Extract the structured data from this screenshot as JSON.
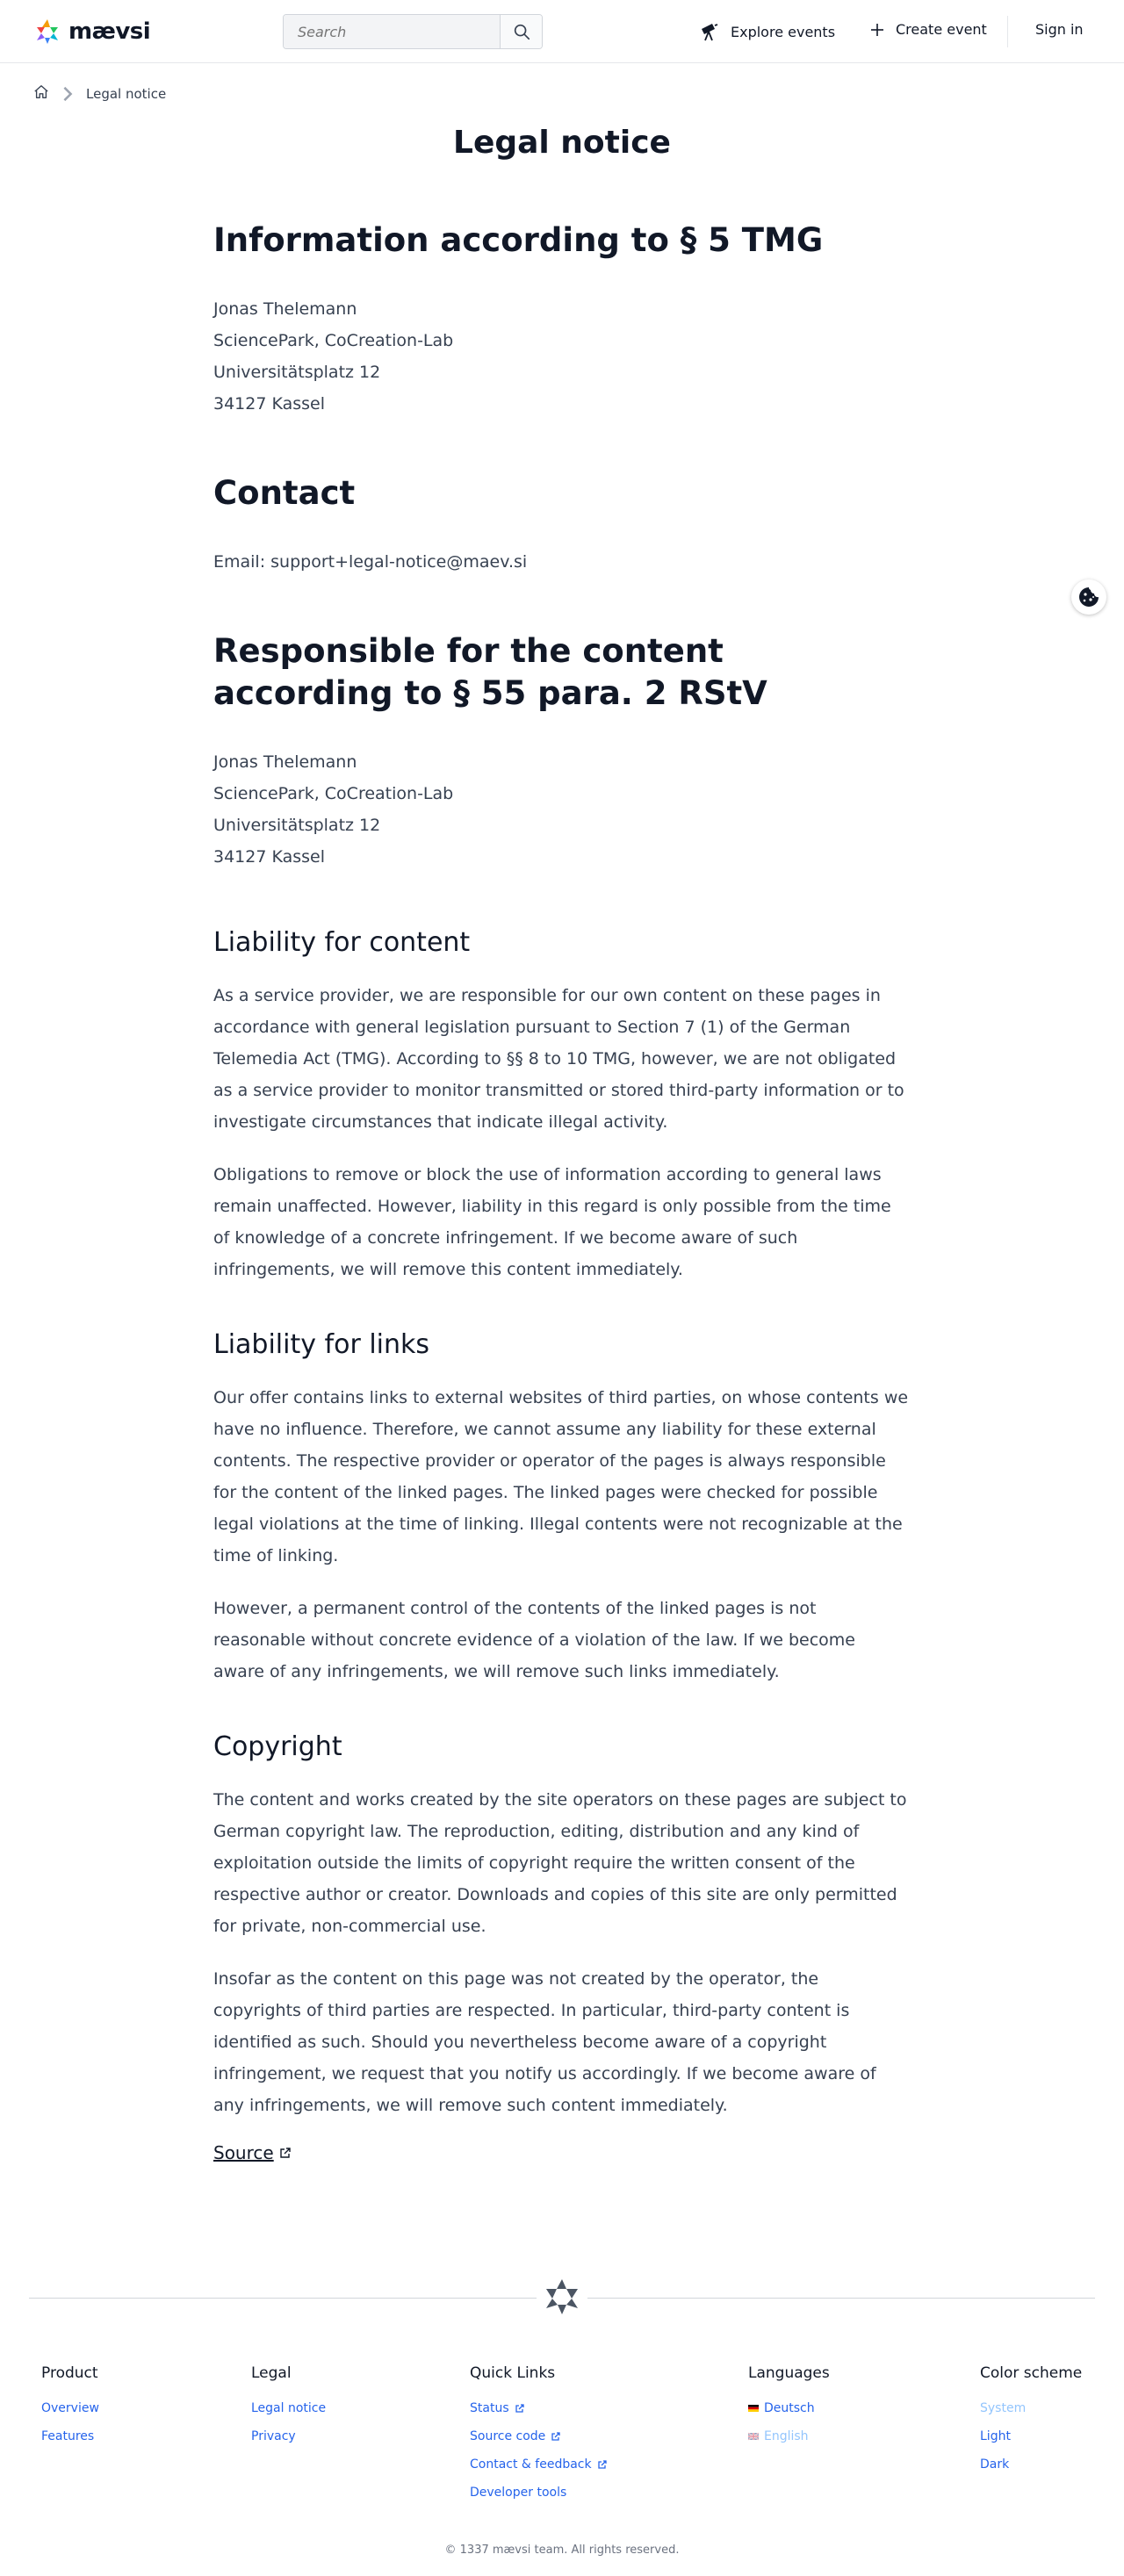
{
  "header": {
    "logo_text": "mævsi",
    "search_placeholder": "Search",
    "explore_label": "Explore events",
    "create_label": "Create event",
    "signin_label": "Sign in"
  },
  "breadcrumb": {
    "current": "Legal notice"
  },
  "page_title": "Legal notice",
  "sections": {
    "info": {
      "heading": "Information according to § 5 TMG",
      "lines": [
        "Jonas Thelemann",
        "SciencePark, CoCreation-Lab",
        "Universitätsplatz 12",
        "34127 Kassel"
      ]
    },
    "contact": {
      "heading": "Contact",
      "email": "Email: support+legal-notice@maev.si"
    },
    "responsible": {
      "heading": "Responsible for the content according to § 55 para. 2 RStV",
      "lines": [
        "Jonas Thelemann",
        "SciencePark, CoCreation-Lab",
        "Universitätsplatz 12",
        "34127 Kassel"
      ]
    },
    "liability_content": {
      "heading": "Liability for content",
      "paragraphs": [
        "As a service provider, we are responsible for our own content on these pages in accordance with general legislation pursuant to Section 7 (1) of the German Telemedia Act (TMG). According to §§ 8 to 10 TMG, however, we are not obligated as a service provider to monitor transmitted or stored third-party information or to investigate circumstances that indicate illegal activity.",
        "Obligations to remove or block the use of information according to general laws remain unaffected. However, liability in this regard is only possible from the time of knowledge of a concrete infringement. If we become aware of such infringements, we will remove this content immediately."
      ]
    },
    "liability_links": {
      "heading": "Liability for links",
      "paragraphs": [
        "Our offer contains links to external websites of third parties, on whose contents we have no influence. Therefore, we cannot assume any liability for these external contents. The respective provider or operator of the pages is always responsible for the content of the linked pages. The linked pages were checked for possible legal violations at the time of linking. Illegal contents were not recognizable at the time of linking.",
        "However, a permanent control of the contents of the linked pages is not reasonable without concrete evidence of a violation of the law. If we become aware of any infringements, we will remove such links immediately."
      ]
    },
    "copyright": {
      "heading": "Copyright",
      "paragraphs": [
        "The content and works created by the site operators on these pages are subject to German copyright law. The reproduction, editing, distribution and any kind of exploitation outside the limits of copyright require the written consent of the respective author or creator. Downloads and copies of this site are only permitted for private, non-commercial use.",
        "Insofar as the content on this page was not created by the operator, the copyrights of third parties are respected. In particular, third-party content is identified as such. Should you nevertheless become aware of a copyright infringement, we request that you notify us accordingly. If we become aware of any infringements, we will remove such content immediately."
      ],
      "source_label": "Source"
    }
  },
  "footer": {
    "product": {
      "title": "Product",
      "links": [
        "Overview",
        "Features"
      ]
    },
    "legal": {
      "title": "Legal",
      "links": [
        "Legal notice",
        "Privacy"
      ]
    },
    "quick_links": {
      "title": "Quick Links",
      "links": [
        "Status",
        "Source code",
        "Contact & feedback",
        "Developer tools"
      ]
    },
    "languages": {
      "title": "Languages",
      "links": [
        "Deutsch",
        "English"
      ]
    },
    "color_scheme": {
      "title": "Color scheme",
      "links": [
        "System",
        "Light",
        "Dark"
      ]
    },
    "copyright": "© 1337 mævsi team. All rights reserved."
  },
  "colors": {
    "link": "#2563eb",
    "link_disabled": "#93c5fd",
    "heading": "#111827",
    "body": "#374151"
  }
}
